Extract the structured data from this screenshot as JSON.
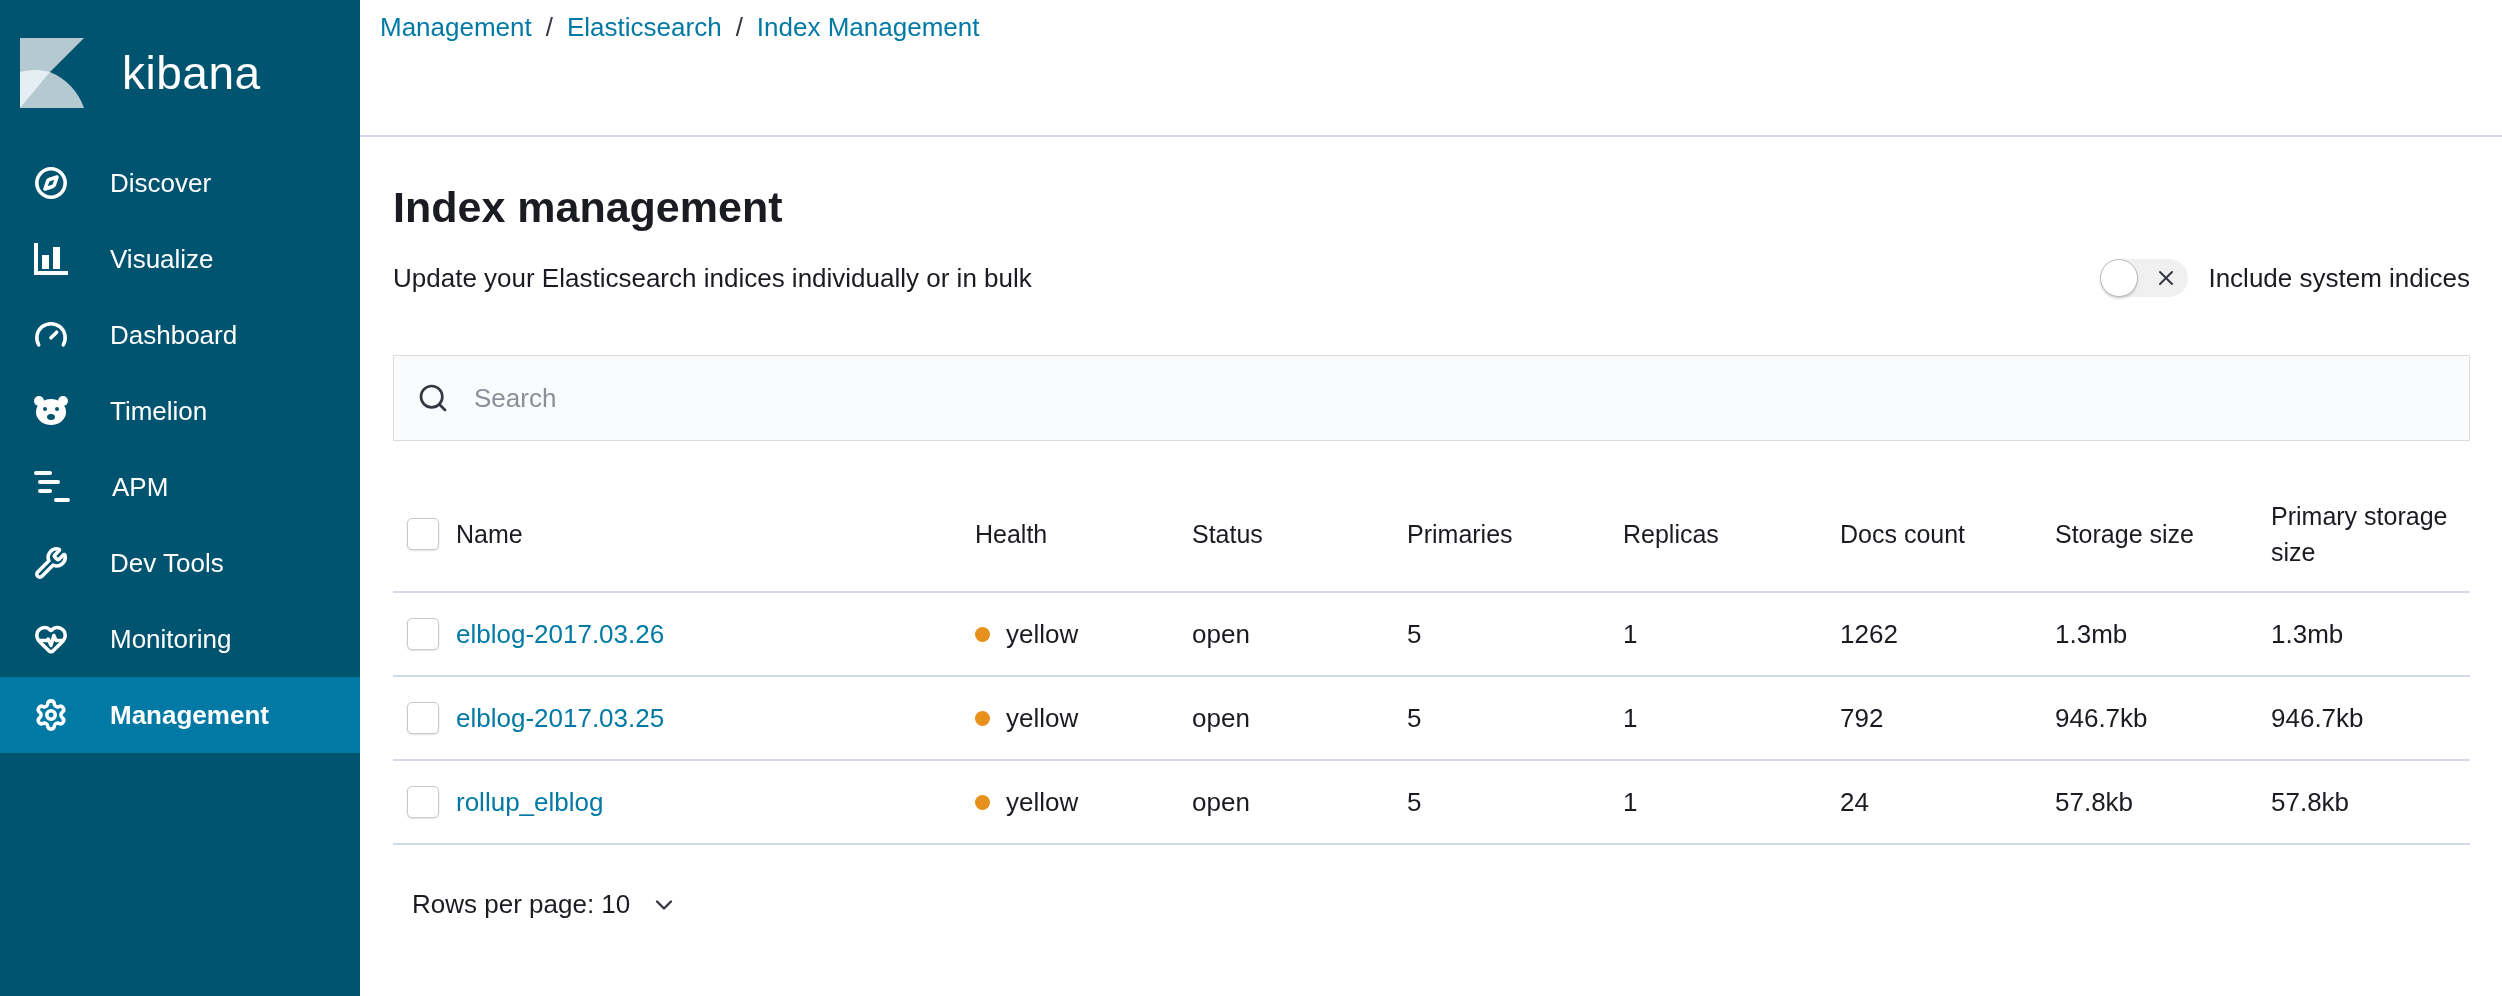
{
  "sidebar": {
    "logo_text": "kibana",
    "items": [
      {
        "label": "Discover",
        "selected": false
      },
      {
        "label": "Visualize",
        "selected": false
      },
      {
        "label": "Dashboard",
        "selected": false
      },
      {
        "label": "Timelion",
        "selected": false
      },
      {
        "label": "APM",
        "selected": false
      },
      {
        "label": "Dev Tools",
        "selected": false
      },
      {
        "label": "Monitoring",
        "selected": false
      },
      {
        "label": "Management",
        "selected": true
      }
    ]
  },
  "breadcrumbs": [
    "Management",
    "Elasticsearch",
    "Index Management"
  ],
  "breadcrumb_separator": "/",
  "page": {
    "title": "Index management",
    "subtitle": "Update your Elasticsearch indices individually or in bulk"
  },
  "toggle": {
    "label": "Include system indices",
    "on": false
  },
  "search": {
    "placeholder": "Search"
  },
  "table": {
    "select_all_checked": false,
    "columns": [
      "Name",
      "Health",
      "Status",
      "Primaries",
      "Replicas",
      "Docs count",
      "Storage size",
      "Primary storage size"
    ],
    "rows": [
      {
        "checked": false,
        "name": "elblog-2017.03.26",
        "health": "yellow",
        "color": "#e7901c",
        "status": "open",
        "primaries": "5",
        "replicas": "1",
        "docs_count": "1262",
        "storage_size": "1.3mb",
        "primary_storage_size": "1.3mb"
      },
      {
        "checked": false,
        "name": "elblog-2017.03.25",
        "health": "yellow",
        "color": "#e7901c",
        "status": "open",
        "primaries": "5",
        "replicas": "1",
        "docs_count": "792",
        "storage_size": "946.7kb",
        "primary_storage_size": "946.7kb"
      },
      {
        "checked": false,
        "name": "rollup_elblog",
        "health": "yellow",
        "color": "#e7901c",
        "status": "open",
        "primaries": "5",
        "replicas": "1",
        "docs_count": "24",
        "storage_size": "57.8kb",
        "primary_storage_size": "57.8kb"
      }
    ]
  },
  "pagination": {
    "rows_per_page": "Rows per page: 10"
  }
}
